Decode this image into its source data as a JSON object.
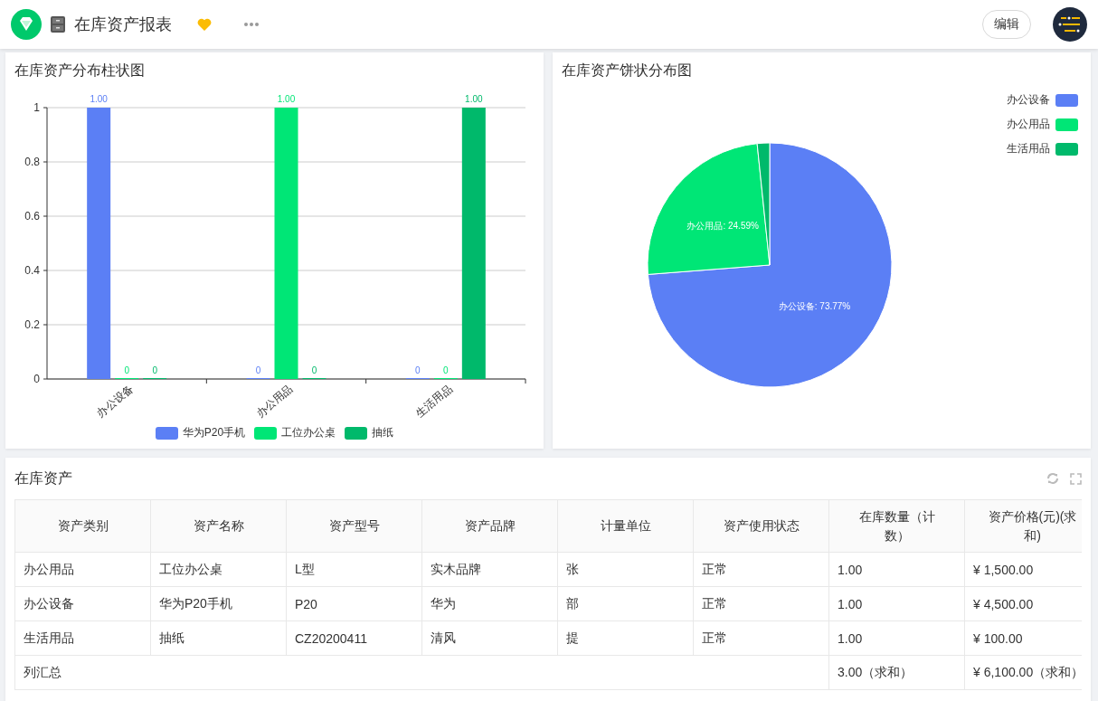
{
  "header": {
    "title": "在库资产报表",
    "edit_button": "编辑"
  },
  "bar_chart": {
    "title": "在库资产分布柱状图",
    "chart_data": {
      "type": "bar",
      "categories": [
        "办公设备",
        "办公用品",
        "生活用品"
      ],
      "series": [
        {
          "name": "华为P20手机",
          "color": "#5b7ff5",
          "values": [
            1,
            0,
            0
          ],
          "value_labels": [
            "1.00",
            "0",
            "0"
          ]
        },
        {
          "name": "工位办公桌",
          "color": "#00e676",
          "values": [
            0,
            1,
            0
          ],
          "value_labels": [
            "0",
            "1.00",
            "0"
          ]
        },
        {
          "name": "抽纸",
          "color": "#00b96b",
          "values": [
            0,
            0,
            1
          ],
          "value_labels": [
            "0",
            "0",
            "1.00"
          ]
        }
      ],
      "ylim": [
        0,
        1
      ],
      "yticks": [
        0,
        0.2,
        0.4,
        0.6,
        0.8,
        1
      ],
      "grid": true
    }
  },
  "pie_chart": {
    "title": "在库资产饼状分布图",
    "chart_data": {
      "type": "pie",
      "categories": [
        "办公设备",
        "办公用品",
        "生活用品"
      ],
      "values": [
        73.77,
        24.59,
        1.64
      ],
      "colors": [
        "#5b7ff5",
        "#00e676",
        "#00b96b"
      ],
      "annotations": [
        {
          "text": "办公设备: 73.77%"
        },
        {
          "text": "办公用品: 24.59%"
        }
      ]
    }
  },
  "table": {
    "title": "在库资产",
    "columns": [
      "资产类别",
      "资产名称",
      "资产型号",
      "资产品牌",
      "计量单位",
      "资产使用状态",
      "在库数量（计数）",
      "资产价格(元)(求和)"
    ],
    "rows": [
      [
        "办公用品",
        "工位办公桌",
        "L型",
        "实木品牌",
        "张",
        "正常",
        "1.00",
        "¥ 1,500.00"
      ],
      [
        "办公设备",
        "华为P20手机",
        "P20",
        "华为",
        "部",
        "正常",
        "1.00",
        "¥ 4,500.00"
      ],
      [
        "生活用品",
        "抽纸",
        "CZ20200411",
        "清风",
        "提",
        "正常",
        "1.00",
        "¥ 100.00"
      ]
    ],
    "summary": {
      "label": "列汇总",
      "cells": [
        "3.00（求和）",
        "¥ 6,100.00（求和）"
      ]
    }
  }
}
